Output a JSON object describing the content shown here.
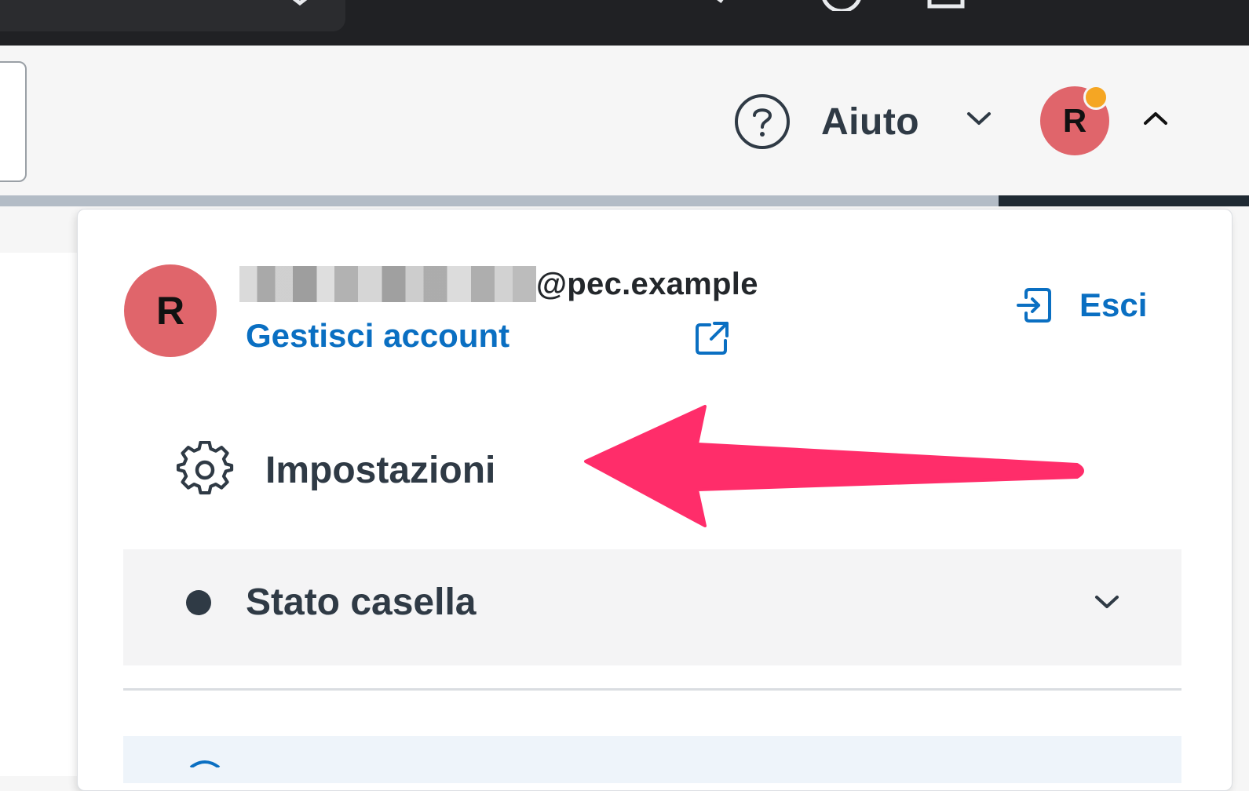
{
  "header": {
    "help_label": "Aiuto",
    "avatar_initial": "R"
  },
  "account": {
    "avatar_initial": "R",
    "email_domain": "@pec.example",
    "manage_label": "Gestisci account",
    "logout_label": "Esci"
  },
  "menu": {
    "settings_label": "Impostazioni",
    "status_label": "Stato casella"
  },
  "colors": {
    "accent_blue": "#0a6fc2",
    "avatar": "#e0656b",
    "notification": "#f5a623",
    "annotation_arrow": "#ff2d6a"
  },
  "icons": [
    "help-circle-icon",
    "chevron-down-icon",
    "chevron-up-icon",
    "external-link-icon",
    "logout-icon",
    "gear-icon",
    "annotation-arrow"
  ]
}
